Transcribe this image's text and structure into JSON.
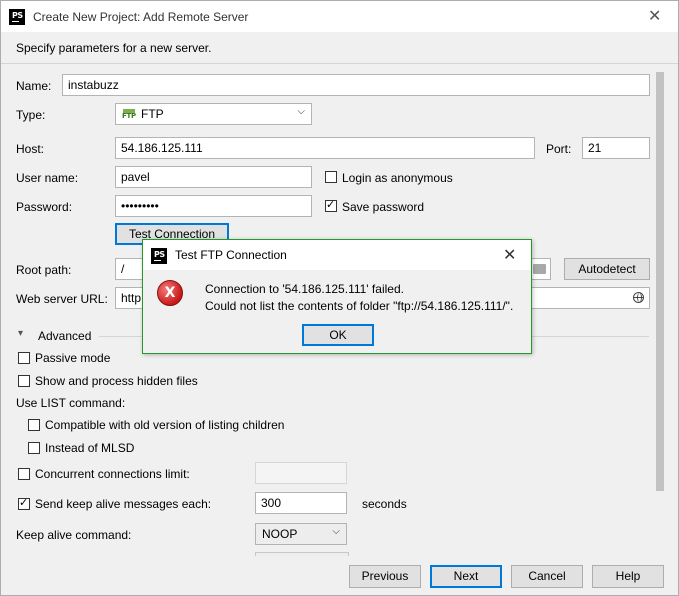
{
  "window": {
    "title": "Create New Project: Add Remote Server",
    "subtitle": "Specify parameters for a new server.",
    "close_glyph": "✕",
    "logo_text": "PS"
  },
  "form": {
    "name_label": "Name:",
    "name_value": "instabuzz",
    "type_label": "Type:",
    "type_value": "FTP",
    "type_icon": "ftp-icon",
    "host_label": "Host:",
    "host_value": "54.186.125.111",
    "port_label": "Port:",
    "port_value": "21",
    "user_label": "User name:",
    "user_value": "pavel",
    "anonymous_label": "Login as anonymous",
    "anonymous_checked": false,
    "password_label": "Password:",
    "password_value": "•••••••••",
    "save_password_label": "Save password",
    "save_password_checked": true,
    "test_connection_label": "Test Connection",
    "root_path_label": "Root path:",
    "root_path_value": "/",
    "autodetect_label": "Autodetect",
    "web_url_label": "Web server URL:",
    "web_url_value": "http"
  },
  "advanced": {
    "header": "Advanced",
    "passive_mode_label": "Passive mode",
    "passive_mode_checked": false,
    "hidden_files_label": "Show and process hidden files",
    "hidden_files_checked": false,
    "list_command_label": "Use  LIST command:",
    "compat_label": "Compatible with old version of listing children",
    "compat_checked": false,
    "mlsd_label": "Instead of MLSD",
    "mlsd_checked": false,
    "concurrent_label": "Concurrent connections limit:",
    "concurrent_checked": false,
    "concurrent_value": "",
    "keepalive_label": "Send keep alive messages each:",
    "keepalive_checked": true,
    "keepalive_value": "300",
    "keepalive_unit": "seconds",
    "keepalive_cmd_label": "Keep alive command:",
    "keepalive_cmd_value": "NOOP"
  },
  "buttons": {
    "previous": "Previous",
    "next": "Next",
    "cancel": "Cancel",
    "help": "Help"
  },
  "dialog": {
    "title": "Test FTP Connection",
    "close_glyph": "✕",
    "logo_text": "PS",
    "error_glyph": "X",
    "message_line1": "Connection to '54.186.125.111' failed.",
    "message_line2": "Could not list the contents of folder \"ftp://54.186.125.111/\".",
    "ok_label": "OK"
  },
  "icons": {
    "checkmark": "✓",
    "dropdown_arrow": "⌵",
    "collapse_arrow": "▾"
  },
  "colors": {
    "dialog_border": "#239c27",
    "default_button_border": "#0078d7",
    "error_red": "#c81818"
  }
}
